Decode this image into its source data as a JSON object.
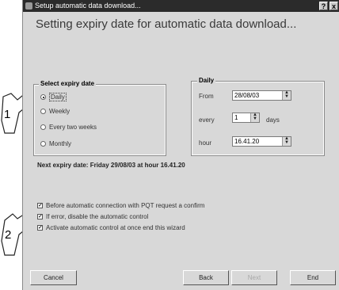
{
  "window": {
    "title": "Setup automatic data download...",
    "help_label": "?",
    "close_label": "x"
  },
  "heading": "Setting expiry date for automatic data download...",
  "select_group": {
    "title": "Select expiry date",
    "options": [
      {
        "label": "Daily",
        "selected": true
      },
      {
        "label": "Weekly",
        "selected": false
      },
      {
        "label": "Every two weeks",
        "selected": false
      },
      {
        "label": "Monthly",
        "selected": false
      }
    ]
  },
  "daily_group": {
    "title": "Daily",
    "from_label": "From",
    "from_value": "28/08/03",
    "every_label": "every",
    "every_value": "1",
    "days_label": "days",
    "hour_label": "hour",
    "hour_value": "16.41.20"
  },
  "next_expiry": "Next expiry date: Friday 29/08/03 at hour 16.41.20",
  "checkboxes": [
    {
      "label": "Before automatic connection with PQT request a confirm",
      "checked": true
    },
    {
      "label": "If error, disable the automatic control",
      "checked": true
    },
    {
      "label": "Activate automatic control at once end this wizard",
      "checked": true
    }
  ],
  "buttons": {
    "cancel": "Cancel",
    "back": "Back",
    "next": "Next",
    "end": "End"
  },
  "callouts": {
    "one": "1",
    "two": "2"
  }
}
